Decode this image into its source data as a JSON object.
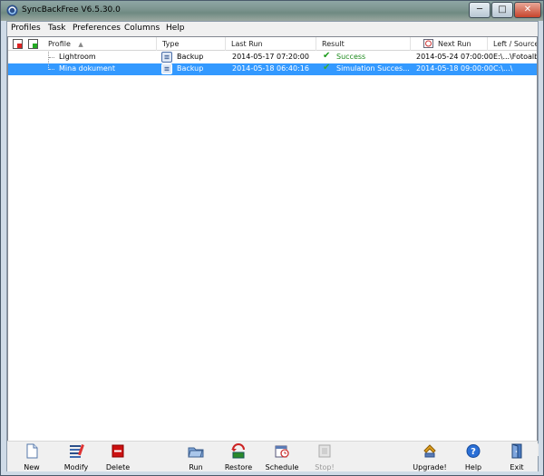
{
  "window": {
    "title": "SyncBackFree V6.5.30.0",
    "controls": {
      "minimize": "─",
      "maximize": "□",
      "close": "✕"
    }
  },
  "menu": [
    "Profiles",
    "Task",
    "Preferences",
    "Columns",
    "Help"
  ],
  "columns": {
    "profile": "Profile",
    "type": "Type",
    "last_run": "Last Run",
    "result": "Result",
    "next_run": "Next Run",
    "left_source": "Left / Source"
  },
  "rows": [
    {
      "profile": "Lightroom",
      "type": "Backup",
      "last_run": "2014-05-17 07:20:00",
      "result": "Success",
      "next_run": "2014-05-24 07:00:00",
      "left_source": "E:\\...\\Fotoalb",
      "selected": false
    },
    {
      "profile": "Mina dokument",
      "type": "Backup",
      "last_run": "2014-05-18 06:40:16",
      "result": "Simulation Succes...",
      "next_run": "2014-05-18 09:00:00",
      "left_source": "C:\\...\\",
      "selected": true
    }
  ],
  "toolbar": {
    "new": "New",
    "modify": "Modify",
    "delete": "Delete",
    "run": "Run",
    "restore": "Restore",
    "schedule": "Schedule",
    "stop": "Stop!",
    "upgrade": "Upgrade!",
    "help": "Help",
    "exit": "Exit"
  },
  "colors": {
    "selection": "#3399ff",
    "success": "#1c8a1c",
    "delete_red": "#cc1111",
    "help_blue": "#2a6fd6"
  }
}
